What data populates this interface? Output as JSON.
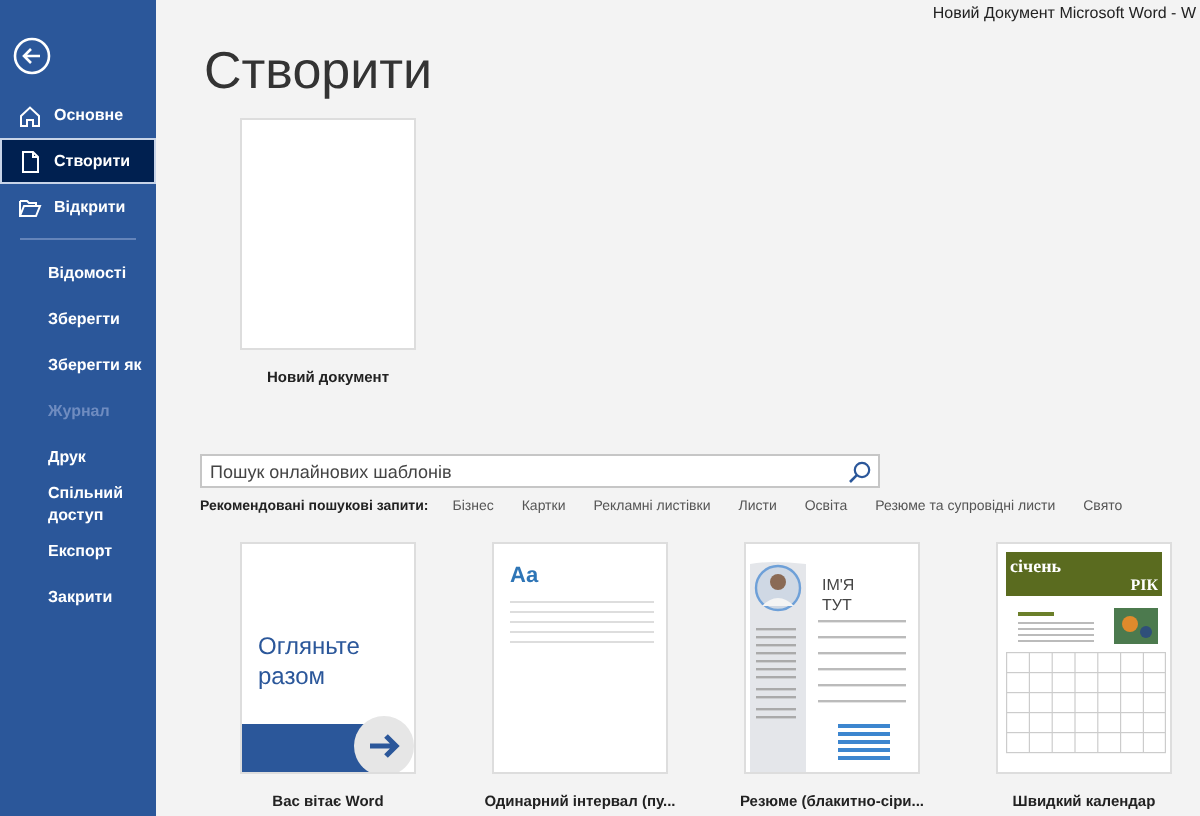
{
  "window": {
    "title": "Новий Документ Microsoft Word  -  W"
  },
  "sidebar": {
    "items": [
      {
        "label": "Основне",
        "kind": "home",
        "selected": false,
        "disabled": false
      },
      {
        "label": "Створити",
        "kind": "new",
        "selected": true,
        "disabled": false
      },
      {
        "label": "Відкрити",
        "kind": "open",
        "selected": false,
        "disabled": false
      },
      {
        "label": "Відомості",
        "selected": false,
        "disabled": false,
        "divider_before": true
      },
      {
        "label": "Зберегти",
        "selected": false,
        "disabled": false
      },
      {
        "label": "Зберегти як",
        "selected": false,
        "disabled": false
      },
      {
        "label": "Журнал",
        "selected": false,
        "disabled": true
      },
      {
        "label": "Друк",
        "selected": false,
        "disabled": false
      },
      {
        "label": "Спільний доступ",
        "selected": false,
        "disabled": false
      },
      {
        "label": "Експорт",
        "selected": false,
        "disabled": false
      },
      {
        "label": "Закрити",
        "selected": false,
        "disabled": false
      }
    ]
  },
  "heading": "Створити",
  "blank": {
    "label": "Новий документ"
  },
  "search": {
    "placeholder": "Пошук онлайнових шаблонів"
  },
  "suggested": {
    "label": "Рекомендовані пошукові запити:",
    "items": [
      "Бізнес",
      "Картки",
      "Рекламні листівки",
      "Листи",
      "Освіта",
      "Резюме та супровідні листи",
      "Свято"
    ]
  },
  "templates": [
    {
      "kind": "tour",
      "label": "Вас вітає Word",
      "texts": [
        "Огляньте разом"
      ]
    },
    {
      "kind": "blank_spacing",
      "label": "Одинарний інтервал (пу...",
      "texts": [
        "Aa"
      ]
    },
    {
      "kind": "resume",
      "label": "Резюме (блакитно-сіри...",
      "texts": [
        "ІМ'Я",
        "ТУТ"
      ]
    },
    {
      "kind": "calendar",
      "label": "Швидкий календар",
      "texts": [
        "січень",
        "РІК"
      ]
    }
  ]
}
